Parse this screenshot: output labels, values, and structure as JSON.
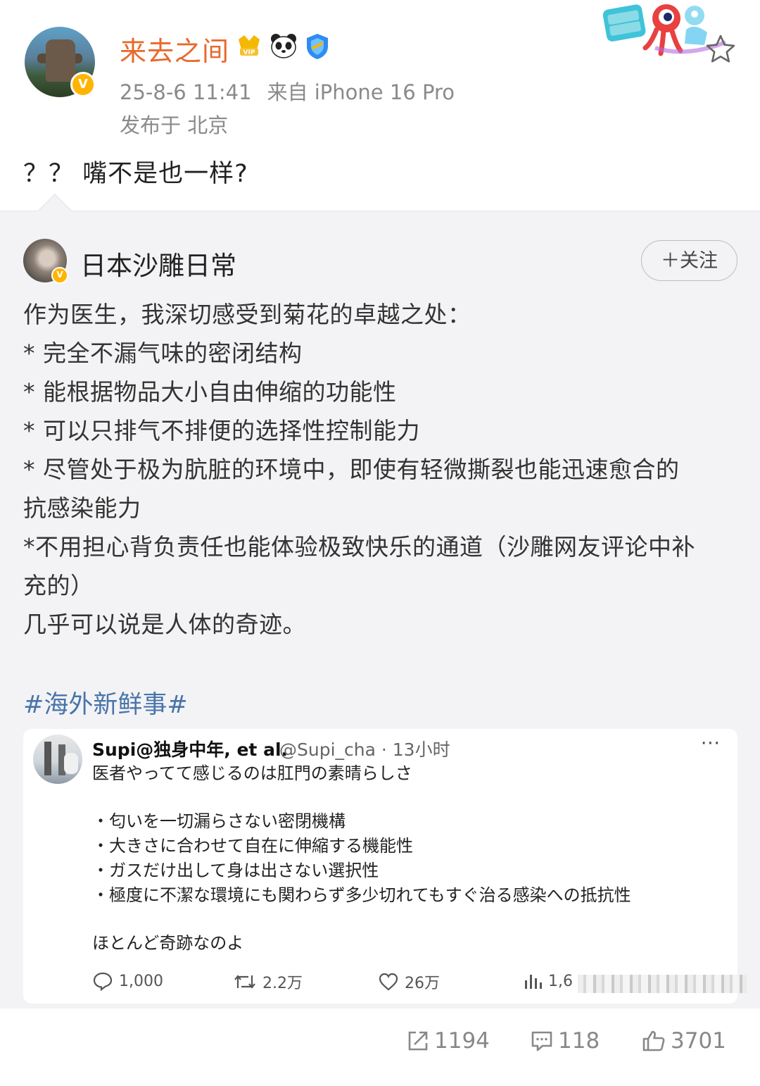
{
  "post": {
    "author": "来去之间",
    "timestamp": "25-8-6 11:41",
    "source": "来自 iPhone 16 Pro",
    "location": "发布于 北京",
    "text": "？？ 嘴不是也一样?",
    "badges": [
      "vip-icon",
      "panda-icon",
      "verified-shield-icon"
    ],
    "avatar_badge": "V"
  },
  "repost": {
    "author": "日本沙雕日常",
    "follow_label": "＋关注",
    "avatar_badge": "V",
    "body": [
      "作为医生，我深切感受到菊花的卓越之处：",
      "* 完全不漏气味的密闭结构",
      "* 能根据物品大小自由伸缩的功能性",
      "* 可以只排气不排便的选择性控制能力",
      "* 尽管处于极为肮脏的环境中，即使有轻微撕裂也能迅速愈合的",
      "抗感染能力",
      "*不用担心背负责任也能体验极致快乐的通道（沙雕网友评论中补",
      "充的）",
      "几乎可以说是人体的奇迹。"
    ],
    "hashtag": "#海外新鲜事#"
  },
  "tweet": {
    "name": "Supi@独身中年, et al.",
    "handle": "@Supi_cha · 13小时",
    "more": "···",
    "lines": [
      "医者やってて感じるのは肛門の素晴らしさ",
      "",
      "・匂いを一切漏らさない密閉機構",
      "・大きさに合わせて自在に伸縮する機能性",
      "・ガスだけ出して身は出さない選択性",
      "・極度に不潔な環境にも関わらず多少切れてもすぐ治る感染への抵抗性",
      "",
      "ほとんど奇跡なのよ"
    ],
    "replies": "1,000",
    "retweets": "2.2万",
    "likes": "26万",
    "views": "1,6"
  },
  "footer": {
    "shares": "1194",
    "comments": "118",
    "likes": "3701"
  },
  "colors": {
    "username": "#e8692c",
    "hashtag": "#4874aa",
    "repost_bg": "#f3f3f5",
    "meta_gray": "#8a8a8a"
  }
}
